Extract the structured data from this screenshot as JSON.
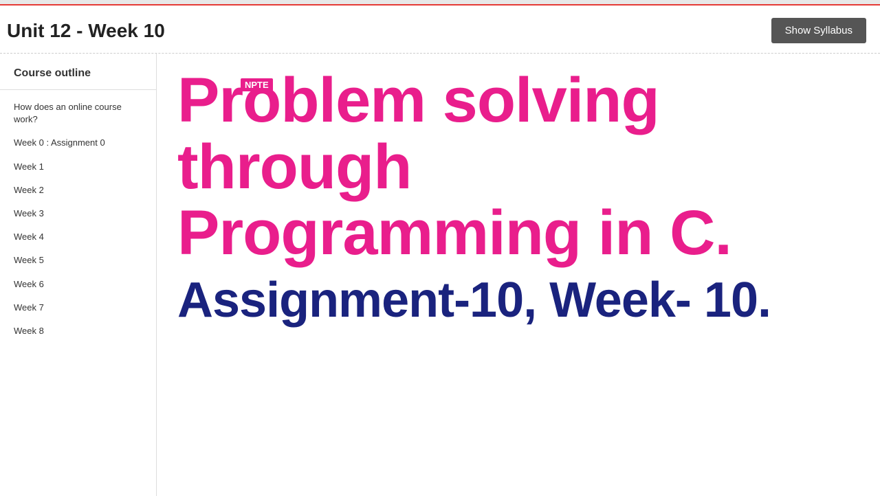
{
  "topbar": {},
  "header": {
    "title": "Unit 12 - Week 10",
    "show_syllabus_label": "Show Syllabus"
  },
  "sidebar": {
    "title": "Course outline",
    "items": [
      {
        "label": "How does an online course work?",
        "active": false
      },
      {
        "label": "Week 0 : Assignment 0",
        "active": false
      },
      {
        "label": "Week 1",
        "active": false
      },
      {
        "label": "Week 2",
        "active": false
      },
      {
        "label": "Week 3",
        "active": false
      },
      {
        "label": "Week 4",
        "active": false
      },
      {
        "label": "Week 5",
        "active": false
      },
      {
        "label": "Week 6",
        "active": false
      },
      {
        "label": "Week 7",
        "active": false
      },
      {
        "label": "Week 8",
        "active": false
      }
    ]
  },
  "content": {
    "nptel_badge": "NPTE",
    "course_title_line1": "Problem solving through",
    "course_title_line2": "Programming in C.",
    "assignment_title": "Assignment-10, Week- 10."
  }
}
